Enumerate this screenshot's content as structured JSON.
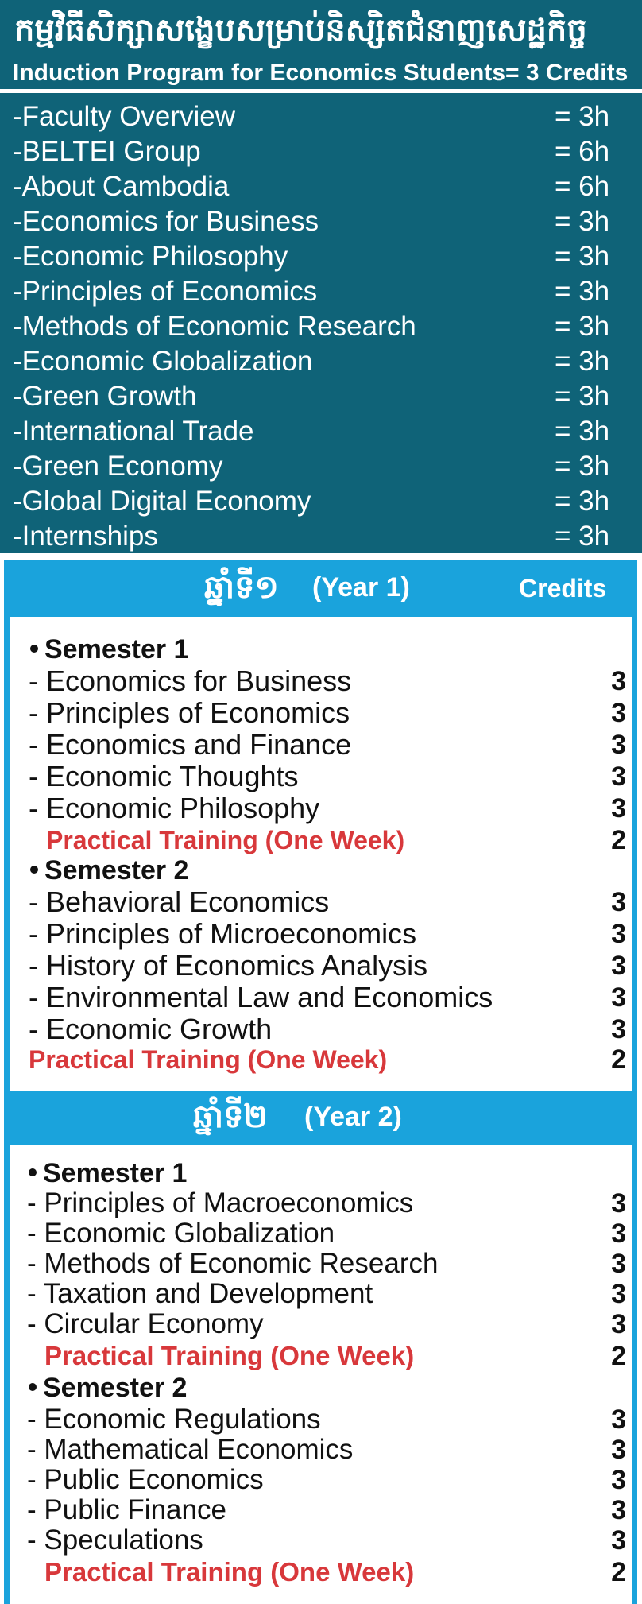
{
  "header": {
    "title_khmer": "កម្មវិធីសិក្សាសង្ខេបសម្រាប់និស្សិតជំនាញសេដ្ឋកិច្ច",
    "title_english": "Induction Program for Economics Students= 3 Credits"
  },
  "induction": {
    "items": [
      {
        "name": "-Faculty Overview",
        "hours": "= 3h"
      },
      {
        "name": "-BELTEI Group",
        "hours": "= 6h"
      },
      {
        "name": "-About Cambodia",
        "hours": "= 6h"
      },
      {
        "name": "-Economics for Business",
        "hours": "= 3h"
      },
      {
        "name": "-Economic Philosophy",
        "hours": "= 3h"
      },
      {
        "name": "-Principles of Economics",
        "hours": "= 3h"
      },
      {
        "name": "-Methods of Economic Research",
        "hours": "= 3h"
      },
      {
        "name": "-Economic Globalization",
        "hours": "= 3h"
      },
      {
        "name": "-Green Growth",
        "hours": "= 3h"
      },
      {
        "name": "-International Trade",
        "hours": "= 3h"
      },
      {
        "name": "-Green Economy",
        "hours": "= 3h"
      },
      {
        "name": "-Global Digital Economy",
        "hours": "= 3h"
      },
      {
        "name": "-Internships",
        "hours": "= 3h"
      }
    ]
  },
  "year1": {
    "title_khmer": "ឆ្នាំទី១",
    "title_english": "(Year 1)",
    "credits_label": "Credits",
    "semester1": {
      "label": "Semester 1",
      "courses": [
        {
          "name": "- Economics for Business",
          "credits": "3"
        },
        {
          "name": "- Principles of Economics",
          "credits": "3"
        },
        {
          "name": "- Economics and Finance",
          "credits": "3"
        },
        {
          "name": "- Economic Thoughts",
          "credits": "3"
        },
        {
          "name": "- Economic Philosophy",
          "credits": "3"
        }
      ],
      "practical": {
        "name": "Practical Training (One Week)",
        "credits": "2"
      }
    },
    "semester2": {
      "label": "Semester 2",
      "courses": [
        {
          "name": "- Behavioral Economics",
          "credits": "3"
        },
        {
          "name": "- Principles of Microeconomics",
          "credits": "3"
        },
        {
          "name": "- History of Economics Analysis",
          "credits": "3"
        },
        {
          "name": "- Environmental Law and Economics",
          "credits": "3"
        },
        {
          "name": "- Economic Growth",
          "credits": "3"
        }
      ],
      "practical": {
        "name": "Practical Training (One Week)",
        "credits": "2"
      }
    }
  },
  "year2": {
    "title_khmer": "ឆ្នាំទី២",
    "title_english": "(Year 2)",
    "semester1": {
      "label": "Semester 1",
      "courses": [
        {
          "name": "- Principles of Macroeconomics",
          "credits": "3"
        },
        {
          "name": "- Economic Globalization",
          "credits": "3"
        },
        {
          "name": "- Methods of Economic Research",
          "credits": "3"
        },
        {
          "name": "- Taxation and Development",
          "credits": "3"
        },
        {
          "name": "- Circular Economy",
          "credits": "3"
        }
      ],
      "practical": {
        "name": "Practical Training (One Week)",
        "credits": "2"
      }
    },
    "semester2": {
      "label": "Semester 2",
      "courses": [
        {
          "name": "- Economic Regulations",
          "credits": "3"
        },
        {
          "name": "- Mathematical Economics",
          "credits": "3"
        },
        {
          "name": "- Public Economics",
          "credits": "3"
        },
        {
          "name": "- Public Finance",
          "credits": "3"
        },
        {
          "name": "- Speculations",
          "credits": "3"
        }
      ],
      "practical": {
        "name": "Practical Training (One Week)",
        "credits": "2"
      }
    }
  }
}
